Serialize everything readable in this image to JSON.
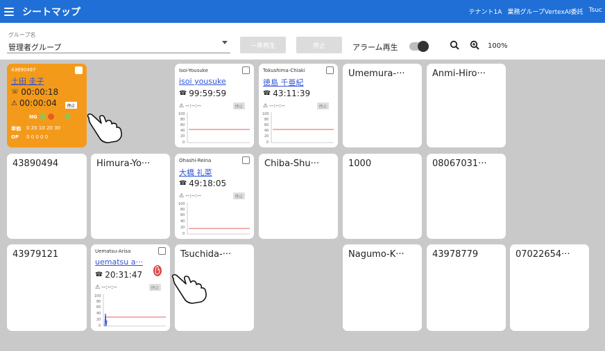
{
  "header": {
    "title": "シートマップ",
    "tenant": "テナント1A",
    "company": "業務グループVertexAI委託",
    "user_trunc": "Tsuc"
  },
  "toolbar": {
    "group_label": "グループ名",
    "group_value": "管理者グループ",
    "bulk_label": "一斉再生",
    "stop_label": "停止",
    "alarm_label": "アラーム再生",
    "zoom_level": "100%"
  },
  "seats": {
    "s1": {
      "id": "43890497",
      "name": "土田 圭子",
      "call_time": "00:00:18",
      "warn_time": "00:00:04",
      "stop": "停止",
      "ng": "NG",
      "row1_label": "単価",
      "row1_vals": "0 20 10 20 30",
      "row2_label": "OP",
      "row2_vals": "0 0 0 0 0"
    },
    "s3": {
      "id": "Isoi-Yousuke",
      "name": "isoi yousuke",
      "time": "99:59:59",
      "warn": "--:--:--",
      "stop": "停止",
      "ticks": [
        "100",
        "80",
        "60",
        "40",
        "20",
        "0"
      ]
    },
    "s4": {
      "id": "Tokushima-Chiaki",
      "name": "徳島 千亜紀",
      "time": "43:11:39",
      "warn": "--:--:--",
      "stop": "停止",
      "ticks": [
        "100",
        "80",
        "60",
        "40",
        "20",
        "0"
      ]
    },
    "s5": {
      "name": "Umemura-···"
    },
    "s6": {
      "name": "Anmi-Hiro···"
    },
    "s7": {
      "name": "43890494"
    },
    "s8": {
      "name": "Himura-Yo···"
    },
    "s9": {
      "id": "Ohashi-Reina",
      "name": "大橋 礼菜",
      "time": "49:18:05",
      "warn": "--:--:--",
      "stop": "停止",
      "ticks": [
        "100",
        "80",
        "60",
        "40",
        "20",
        "0"
      ]
    },
    "s10": {
      "name": "Chiba-Shu···"
    },
    "s11": {
      "name": "1000"
    },
    "s12": {
      "name": "08067031···"
    },
    "s13": {
      "name": "43979121"
    },
    "s14": {
      "id": "Uematsu-Arisa",
      "name": "uematsu a···",
      "time": "20:31:47",
      "warn": "--:--:--",
      "stop": "停止",
      "ticks": [
        "100",
        "80",
        "60",
        "40",
        "20",
        "0"
      ]
    },
    "s15": {
      "name": "Tsuchida-···"
    },
    "s16": {
      "name": "Nagumo-K···"
    },
    "s17": {
      "name": "43978779"
    },
    "s18": {
      "name": "07022654···"
    }
  },
  "colors": {
    "header": "#1f6fd6",
    "alert_card": "#f49a1a",
    "background": "#c9c9c9",
    "link": "#2f54d8",
    "chart_line": "#e06060"
  }
}
